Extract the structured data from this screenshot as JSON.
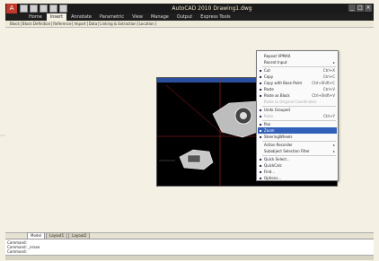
{
  "window": {
    "title": "AutoCAD 2010  Drawing1.dwg",
    "app_menu_icon": "autocad-a-logo",
    "controls": [
      "_",
      "□",
      "×"
    ]
  },
  "ribbon": {
    "tabs": [
      {
        "label": "Home",
        "active": false
      },
      {
        "label": "Insert",
        "active": true
      },
      {
        "label": "Annotate",
        "active": false
      },
      {
        "label": "Parametric",
        "active": false
      },
      {
        "label": "View",
        "active": false
      },
      {
        "label": "Manage",
        "active": false
      },
      {
        "label": "Output",
        "active": false
      },
      {
        "label": "Express Tools",
        "active": false
      }
    ],
    "panels": [
      "Block",
      "Block Definition",
      "Reference",
      "Import",
      "Data",
      "Linking & Extraction",
      "Location"
    ]
  },
  "context_menu": {
    "items": [
      {
        "label": "Repeat VPMAX",
        "shortcut": "",
        "icon": "",
        "state": "normal"
      },
      {
        "label": "Recent Input",
        "shortcut": "",
        "icon": "",
        "state": "normal",
        "submenu": true
      },
      {
        "label": "Cut",
        "shortcut": "Ctrl+X",
        "icon": "scissors-icon",
        "state": "normal"
      },
      {
        "label": "Copy",
        "shortcut": "Ctrl+C",
        "icon": "copy-icon",
        "state": "normal"
      },
      {
        "label": "Copy with Base Point",
        "shortcut": "Ctrl+Shift+C",
        "icon": "copy-base-icon",
        "state": "normal"
      },
      {
        "label": "Paste",
        "shortcut": "Ctrl+V",
        "icon": "paste-icon",
        "state": "normal"
      },
      {
        "label": "Paste as Block",
        "shortcut": "Ctrl+Shift+V",
        "icon": "paste-block-icon",
        "state": "normal"
      },
      {
        "label": "Paste to Original Coordinates",
        "shortcut": "",
        "icon": "",
        "state": "disabled"
      },
      {
        "label": "Undo Grouped",
        "shortcut": "",
        "icon": "undo-icon",
        "state": "normal"
      },
      {
        "label": "Redo",
        "shortcut": "Ctrl+Y",
        "icon": "redo-icon",
        "state": "disabled"
      },
      {
        "label": "Pan",
        "shortcut": "",
        "icon": "pan-icon",
        "state": "normal"
      },
      {
        "label": "Zoom",
        "shortcut": "",
        "icon": "zoom-icon",
        "state": "highlighted"
      },
      {
        "label": "SteeringWheels",
        "shortcut": "",
        "icon": "steeringwheel-icon",
        "state": "normal"
      },
      {
        "label": "Action Recorder",
        "shortcut": "",
        "icon": "",
        "state": "normal",
        "submenu": true
      },
      {
        "label": "Subobject Selection Filter",
        "shortcut": "",
        "icon": "",
        "state": "normal",
        "submenu": true
      },
      {
        "label": "Quick Select...",
        "shortcut": "",
        "icon": "quickselect-icon",
        "state": "normal"
      },
      {
        "label": "QuickCalc",
        "shortcut": "",
        "icon": "calculator-icon",
        "state": "normal"
      },
      {
        "label": "Find...",
        "shortcut": "",
        "icon": "find-icon",
        "state": "normal"
      },
      {
        "label": "Options...",
        "shortcut": "",
        "icon": "options-icon",
        "state": "normal"
      }
    ]
  },
  "layout_tabs": [
    {
      "label": "Model",
      "active": true
    },
    {
      "label": "Layout1",
      "active": false
    },
    {
      "label": "Layout2",
      "active": false
    }
  ],
  "command_line": {
    "lines": [
      "Command:",
      "Command: _erase",
      "Command:"
    ]
  },
  "colors": {
    "canvas": "#f4f1e4",
    "viewport": "#000000",
    "highlight": "#3161b8",
    "titlebar": "#1a1a1a",
    "crosshair_lines": "#b02020"
  }
}
